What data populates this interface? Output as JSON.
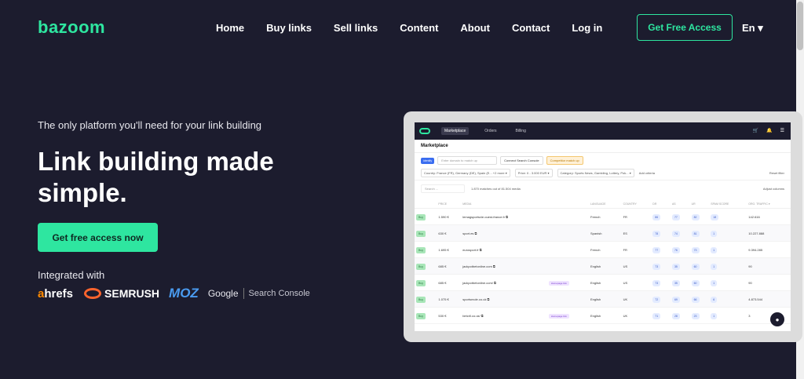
{
  "brand": {
    "logo": "bazoom",
    "accent": "#2ee6a0",
    "background": "#1c1c2e"
  },
  "nav": {
    "items": [
      "Home",
      "Buy links",
      "Sell links",
      "Content",
      "About",
      "Contact",
      "Log in"
    ],
    "cta": "Get Free Access",
    "language": "En ▾"
  },
  "hero": {
    "tagline": "The only platform you'll need for your link building",
    "headline": "Link building made simple.",
    "cta": "Get free access now",
    "integrated_label": "Integrated with",
    "partners": {
      "ahrefs_a": "a",
      "ahrefs_rest": "hrefs",
      "semrush": "SEMRUSH",
      "moz": "MOZ",
      "google": "Google",
      "search_console": "Search Console"
    }
  },
  "mock": {
    "nav_tabs": [
      "Marketplace",
      "Orders",
      "Billing"
    ],
    "page_title": "Marketplace",
    "identify": "identify",
    "search_placeholder": "Enter domain to match up",
    "connect": "Connect Search Console",
    "competitor": "Competitor match up",
    "filters": [
      "Country: France (FR), Germany (DE), Spain (E... +2 more ▾",
      "Price: 0 - 3.000 EUR ▾",
      "Category: Sports News, Gambling, Lottery, Pok... ▾"
    ],
    "add_criteria": "Add criteria",
    "reset": "Reset filter",
    "table_search": "Search ...",
    "matches": "1.870 matches out of 81.504 media",
    "adjust": "Adjust columns",
    "columns": [
      "",
      "PRICE",
      "MEDIA",
      "",
      "LANGUAGE",
      "COUNTRY",
      "DR",
      "AS",
      "UR",
      "SPAM SCORE",
      "ORG. TRAFFIC ▾"
    ],
    "rows": [
      {
        "buy": "Buy",
        "price": "1.590 €",
        "media": "lemagsportsvie.ouest-france.fr ⧉",
        "tag": "",
        "lang": "French",
        "country": "FR",
        "dr": "86",
        "as": "77",
        "ur": "82",
        "spam": "18",
        "traffic": "142.616"
      },
      {
        "buy": "Buy",
        "price": "630 €",
        "media": "sport.es ⧉",
        "tag": "",
        "lang": "Spanish",
        "country": "ES",
        "dr": "78",
        "as": "74",
        "ur": "81",
        "spam": "1",
        "traffic": "10.227.888"
      },
      {
        "buy": "Buy",
        "price": "1.695 €",
        "media": "eurosport.fr ⧉",
        "tag": "",
        "lang": "French",
        "country": "FR",
        "dr": "77",
        "as": "76",
        "ur": "73",
        "spam": "1",
        "traffic": "9.394.285"
      },
      {
        "buy": "Buy",
        "price": "685 €",
        "media": "jackpotbetonline.com ⧉",
        "tag": "",
        "lang": "English",
        "country": "US",
        "dr": "73",
        "as": "35",
        "ur": "60",
        "spam": "1",
        "traffic": "90"
      },
      {
        "buy": "Buy",
        "price": "685 €",
        "media": "jackpotbetonline.com/ ⧉",
        "tag": "Homepage link",
        "lang": "English",
        "country": "US",
        "dr": "73",
        "as": "35",
        "ur": "60",
        "spam": "1",
        "traffic": "90"
      },
      {
        "buy": "Buy",
        "price": "1.075 €",
        "media": "sportsmole.co.uk ⧉",
        "tag": "",
        "lang": "English",
        "country": "UK",
        "dr": "72",
        "as": "69",
        "ur": "66",
        "spam": "6",
        "traffic": "4.873.544"
      },
      {
        "buy": "Buy",
        "price": "530 €",
        "media": "betcrll.co.uk/ ⧉",
        "tag": "Homepage link",
        "lang": "English",
        "country": "UK",
        "dr": "71",
        "as": "28",
        "ur": "23",
        "spam": "1",
        "traffic": "3"
      }
    ]
  }
}
